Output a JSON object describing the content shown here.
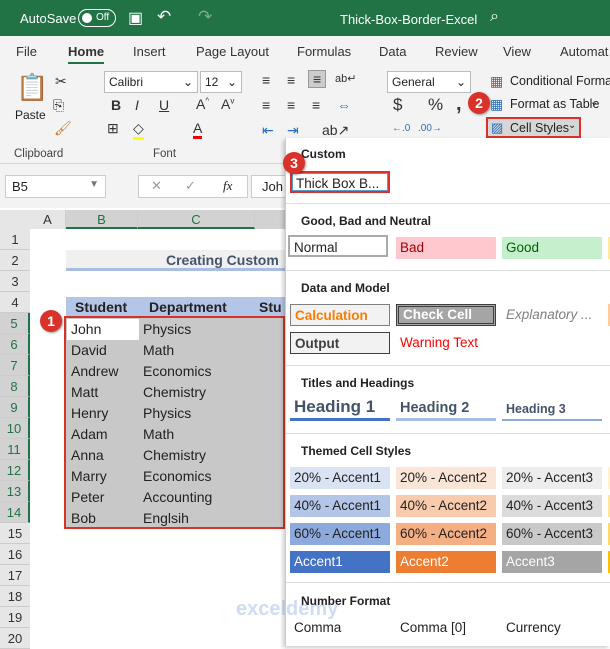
{
  "titlebar": {
    "autosave": "AutoSave",
    "toggle": "Off",
    "filename": "Thick-Box-Border-Excel"
  },
  "tabs": [
    "File",
    "Home",
    "Insert",
    "Page Layout",
    "Formulas",
    "Data",
    "Review",
    "View",
    "Automat"
  ],
  "ribbon": {
    "paste": "Paste",
    "font": "Calibri",
    "size": "12",
    "number_format": "General",
    "conditional": "Conditional Formatting",
    "format_table": "Format as Table",
    "cell_styles": "Cell Styles",
    "groups": {
      "clipboard": "Clipboard",
      "font": "Font"
    }
  },
  "formula_bar": {
    "name_box": "B5",
    "fx": "fx",
    "content": "Joh"
  },
  "columns": [
    "A",
    "B",
    "C",
    "D"
  ],
  "rows": [
    "1",
    "2",
    "3",
    "4",
    "5",
    "6",
    "7",
    "8",
    "9",
    "10",
    "11",
    "12",
    "13",
    "14",
    "15",
    "16",
    "17",
    "18",
    "19",
    "20"
  ],
  "sheet": {
    "title": "Creating Custom",
    "headers": [
      "Student",
      "Department",
      "Stu"
    ],
    "data": [
      [
        "John",
        "Physics"
      ],
      [
        "David",
        "Math"
      ],
      [
        "Andrew",
        "Economics"
      ],
      [
        "Matt",
        "Chemistry"
      ],
      [
        "Henry",
        "Physics"
      ],
      [
        "Adam",
        "Math"
      ],
      [
        "Anna",
        "Chemistry"
      ],
      [
        "Marry",
        "Economics"
      ],
      [
        "Peter",
        "Accounting"
      ],
      [
        "Bob",
        "Englsih"
      ]
    ]
  },
  "panel": {
    "custom": {
      "title": "Custom",
      "item": "Thick Box B..."
    },
    "good_bad": {
      "title": "Good, Bad and Neutral",
      "items": [
        "Normal",
        "Bad",
        "Good"
      ]
    },
    "data_model": {
      "title": "Data and Model",
      "items": [
        "Calculation",
        "Check Cell",
        "Explanatory ...",
        "Output",
        "Warning Text"
      ]
    },
    "titles": {
      "title": "Titles and Headings",
      "items": [
        "Heading 1",
        "Heading 2",
        "Heading 3"
      ]
    },
    "themed": {
      "title": "Themed Cell Styles",
      "items": [
        "20% - Accent1",
        "20% - Accent2",
        "20% - Accent3",
        "40% - Accent1",
        "40% - Accent2",
        "40% - Accent3",
        "60% - Accent1",
        "60% - Accent2",
        "60% - Accent3",
        "Accent1",
        "Accent2",
        "Accent3"
      ]
    },
    "number": {
      "title": "Number Format",
      "items": [
        "Comma",
        "Comma [0]",
        "Currency"
      ]
    }
  },
  "badges": [
    "1",
    "2",
    "3"
  ],
  "watermark": "exceldemy",
  "colors": {
    "excel_green": "#217346",
    "accent1": "#4472c4",
    "accent2": "#ed7d31",
    "accent3": "#a5a5a5",
    "highlight": "#d9322b"
  }
}
